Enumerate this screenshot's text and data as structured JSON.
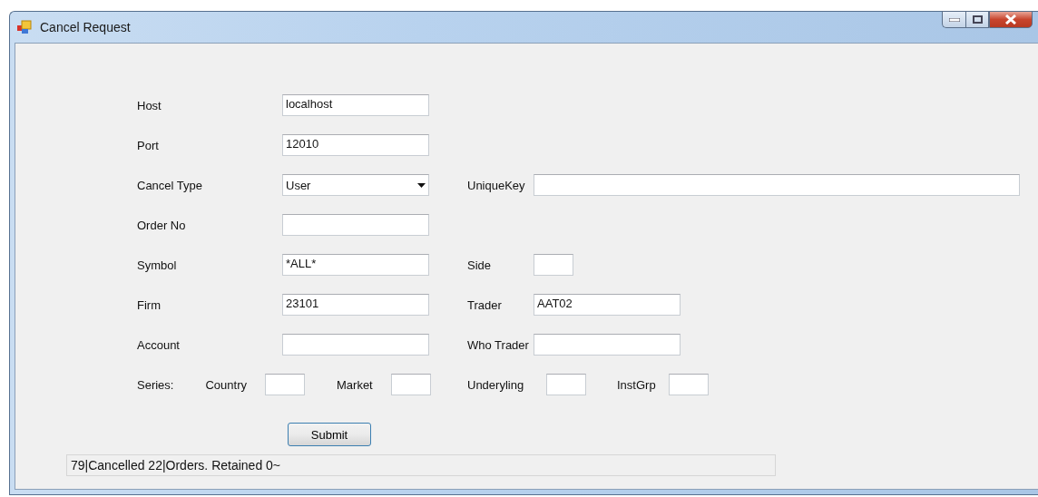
{
  "window": {
    "title": "Cancel Request"
  },
  "rows": [
    {
      "left": {
        "label": "Host",
        "kind": "text",
        "value": "localhost"
      }
    },
    {
      "left": {
        "label": "Port",
        "kind": "text",
        "value": "12010"
      }
    },
    {
      "left": {
        "label": "Cancel Type",
        "kind": "dropdown",
        "value": "User"
      },
      "right": {
        "label": "UniqueKey",
        "kind": "long"
      }
    },
    {
      "left": {
        "label": "Order No",
        "kind": "text"
      }
    },
    {
      "left": {
        "label": "Symbol",
        "kind": "text",
        "value": "*ALL*"
      },
      "right": {
        "label": "Side",
        "kind": "short"
      }
    },
    {
      "left": {
        "label": "Firm",
        "kind": "text",
        "value": "23101"
      },
      "right": {
        "label": "Trader",
        "kind": "text",
        "value": "AAT02"
      }
    },
    {
      "left": {
        "label": "Account",
        "kind": "text"
      },
      "right": {
        "label": "Who Trader",
        "kind": "text"
      }
    },
    {
      "left": {
        "label": "Series:",
        "kind": "group",
        "parts": [
          {
            "label": "Country"
          },
          {
            "label": "Market"
          }
        ]
      },
      "right": {
        "label": "Underyling",
        "kind": "short",
        "extra": {
          "label": "InstGrp"
        }
      }
    }
  ],
  "submit": "Submit",
  "status": "79|Cancelled 22|Orders. Retained 0~"
}
